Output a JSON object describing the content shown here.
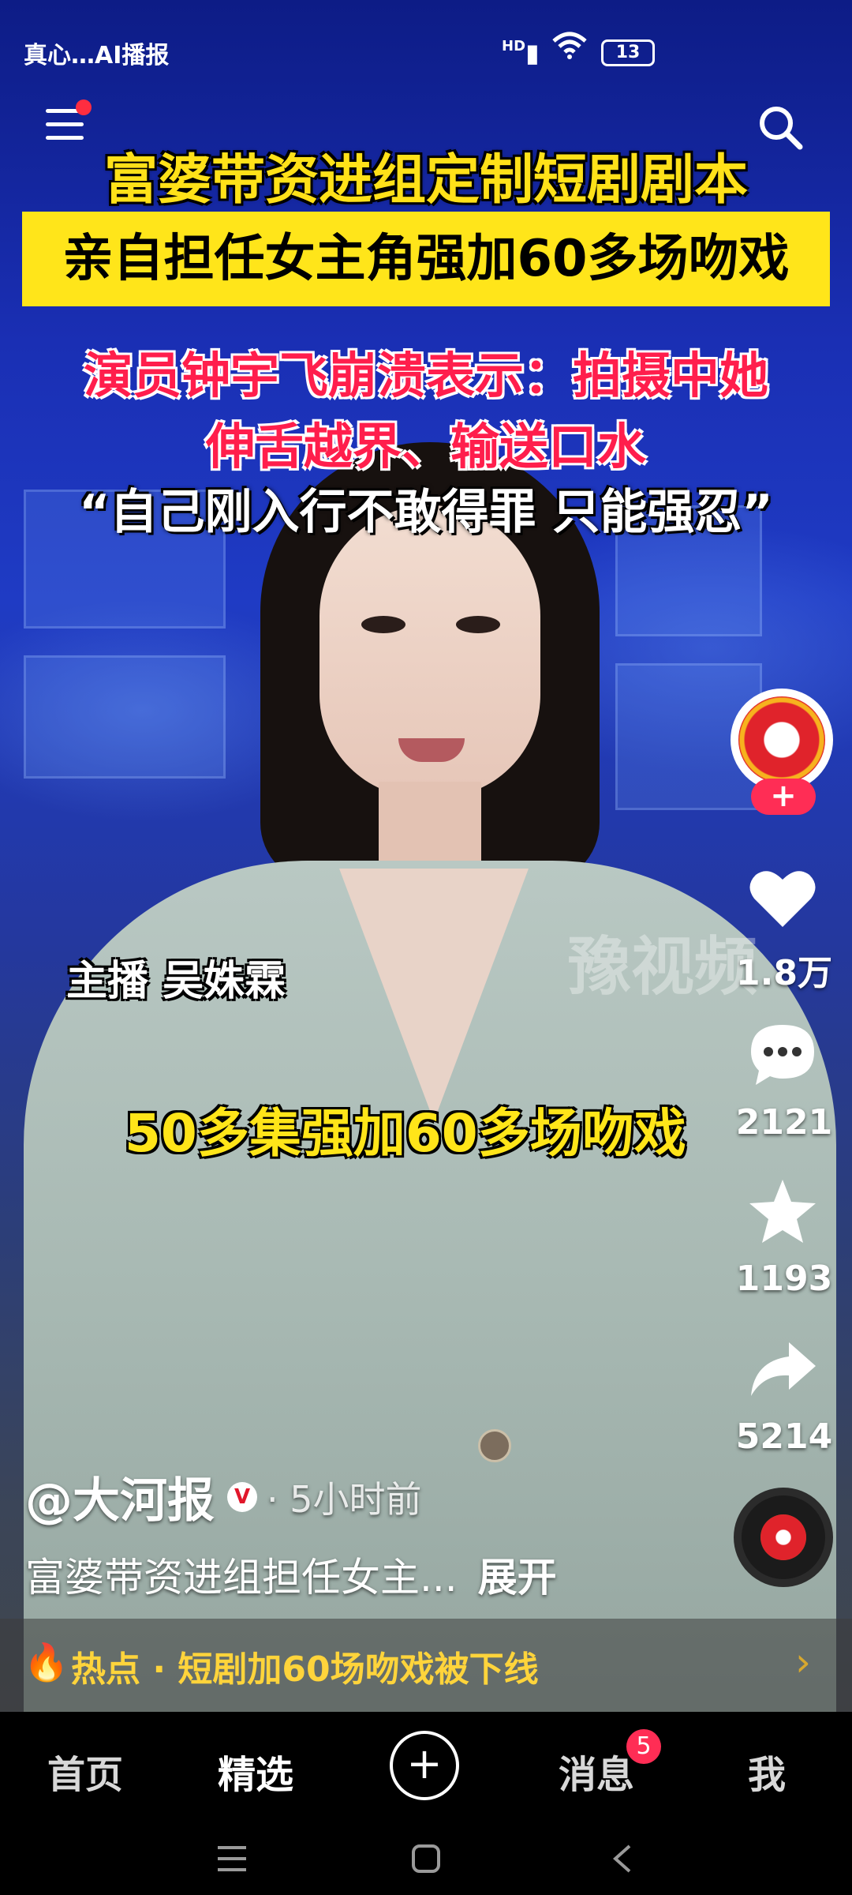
{
  "status_bar": {
    "time": "真心…AI播报",
    "signal": "HD",
    "battery": "13"
  },
  "video": {
    "headline_1": "富婆带资进组定制短剧剧本",
    "headline_2": "亲自担任女主角强加60多场吻戏",
    "headline_3": "演员钟宇飞崩溃表示：拍摄中她",
    "headline_4": "伸舌越界、输送口水",
    "headline_5": "“自己刚入行不敢得罪 只能强忍”",
    "anchor_label": "主播 吴姝霖",
    "mid_caption": "50多集强加60多场吻戏",
    "watermark": "豫视频"
  },
  "actions": {
    "like_count": "1.8万",
    "comment_count": "2121",
    "favorite_count": "1193",
    "share_count": "5214",
    "follow_symbol": "+"
  },
  "author": {
    "name": "@大河报",
    "verified": "V",
    "time": "· 5小时前"
  },
  "description": {
    "text": "富婆带资进组担任女主...",
    "more": "展开"
  },
  "hot_topic": {
    "text": "热点 · 短剧加60场吻戏被下线"
  },
  "bottom_nav": {
    "items": [
      {
        "label": "首页"
      },
      {
        "label": "精选"
      },
      {
        "label": "消息"
      },
      {
        "label": "我"
      }
    ],
    "create": "+",
    "message_badge": "5"
  },
  "icons": {
    "menu": "menu-icon",
    "search": "search-icon",
    "like": "heart-icon",
    "comment": "comment-icon",
    "favorite": "star-icon",
    "share": "share-icon"
  },
  "colors": {
    "headline_yellow": "#ffe119",
    "headline_red": "#ff1e4c",
    "follow_pink": "#ff2d55",
    "hot_text": "#ffd43b"
  }
}
